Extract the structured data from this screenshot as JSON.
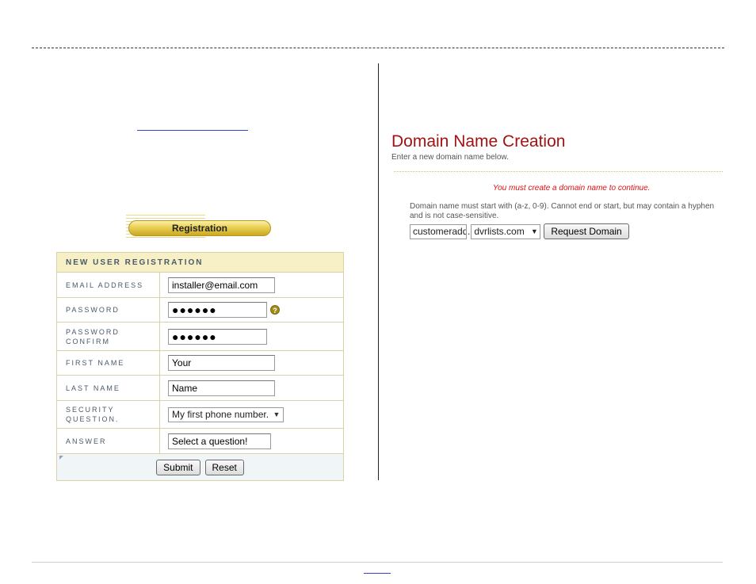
{
  "registration": {
    "badge_label": "Registration",
    "header": "NEW USER REGISTRATION",
    "fields": {
      "email": {
        "label": "EMAIL ADDRESS",
        "value": "installer@email.com"
      },
      "password": {
        "label": "PASSWORD",
        "value": "●●●●●●"
      },
      "password_confirm": {
        "label": "PASSWORD CONFIRM",
        "value": "●●●●●●"
      },
      "first_name": {
        "label": "FIRST NAME",
        "value": "Your"
      },
      "last_name": {
        "label": "LAST NAME",
        "value": "Name"
      },
      "security_question": {
        "label": "SECURITY QUESTION.",
        "value": "My first phone number."
      },
      "answer": {
        "label": "ANSWER",
        "value": "Select a question!"
      }
    },
    "help_icon": "question-icon",
    "submit_label": "Submit",
    "reset_label": "Reset"
  },
  "domain": {
    "title": "Domain Name Creation",
    "subtitle": "Enter a new domain name below.",
    "warning": "You must create a domain name to continue.",
    "rule": "Domain name must start with (a-z, 0-9). Cannot end or start, but may contain a hyphen and is not case-sensitive.",
    "name_value": "customeradd",
    "separator": ".",
    "suffix_value": "dvrlists.com",
    "request_label": "Request Domain"
  },
  "colors": {
    "title_red": "#a31212",
    "warning_red": "#dd1111",
    "header_bg": "#f7f0c6",
    "badge_gold": "#e9cf52"
  }
}
